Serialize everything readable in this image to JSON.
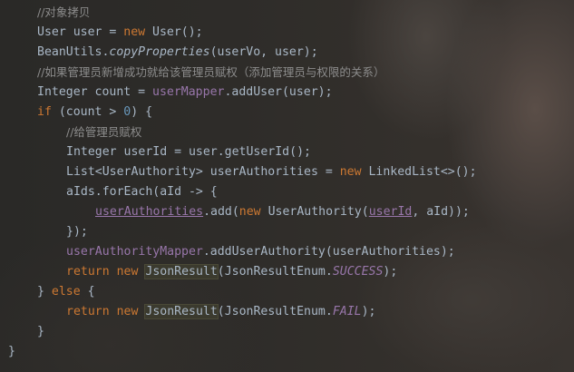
{
  "code_lines": [
    {
      "indent": 41,
      "tokens": [
        {
          "t": "//对象拷贝",
          "c": "comment"
        }
      ]
    },
    {
      "indent": 41,
      "tokens": [
        {
          "t": "User user = ",
          "c": "plain"
        },
        {
          "t": "new",
          "c": "keyword"
        },
        {
          "t": " User();",
          "c": "plain"
        }
      ]
    },
    {
      "indent": 41,
      "tokens": [
        {
          "t": "BeanUtils.",
          "c": "plain"
        },
        {
          "t": "copyProperties",
          "c": "italic"
        },
        {
          "t": "(userVo, user);",
          "c": "plain"
        }
      ]
    },
    {
      "indent": 41,
      "tokens": [
        {
          "t": "//如果管理员新增成功就给该管理员赋权（添加管理员与权限的关系）",
          "c": "comment"
        }
      ]
    },
    {
      "indent": 41,
      "tokens": [
        {
          "t": "Integer count = ",
          "c": "plain"
        },
        {
          "t": "userMapper",
          "c": "field"
        },
        {
          "t": ".addUser(user);",
          "c": "plain"
        }
      ]
    },
    {
      "indent": 41,
      "tokens": [
        {
          "t": "if",
          "c": "keyword"
        },
        {
          "t": " (count > ",
          "c": "plain"
        },
        {
          "t": "0",
          "c": "number"
        },
        {
          "t": ") {",
          "c": "plain"
        }
      ]
    },
    {
      "indent": 73,
      "tokens": [
        {
          "t": "//给管理员赋权",
          "c": "comment"
        }
      ]
    },
    {
      "indent": 73,
      "tokens": [
        {
          "t": "Integer userId = user.getUserId();",
          "c": "plain"
        }
      ]
    },
    {
      "indent": 73,
      "tokens": [
        {
          "t": "List<UserAuthority> userAuthorities = ",
          "c": "plain"
        },
        {
          "t": "new",
          "c": "keyword"
        },
        {
          "t": " LinkedList<>();",
          "c": "plain"
        }
      ]
    },
    {
      "indent": 73,
      "tokens": [
        {
          "t": "aIds.forEach(aId -> {",
          "c": "plain"
        }
      ]
    },
    {
      "indent": 105,
      "tokens": [
        {
          "t": "userAuthorities",
          "c": "field-underline"
        },
        {
          "t": ".add(",
          "c": "plain"
        },
        {
          "t": "new",
          "c": "keyword"
        },
        {
          "t": " UserAuthority(",
          "c": "plain"
        },
        {
          "t": "userId",
          "c": "field-underline"
        },
        {
          "t": ", aId));",
          "c": "plain"
        }
      ]
    },
    {
      "indent": 73,
      "tokens": [
        {
          "t": "});",
          "c": "plain"
        }
      ]
    },
    {
      "indent": 73,
      "tokens": [
        {
          "t": "userAuthorityMapper",
          "c": "field"
        },
        {
          "t": ".addUserAuthority(userAuthorities);",
          "c": "plain"
        }
      ]
    },
    {
      "indent": 73,
      "tokens": [
        {
          "t": "return",
          "c": "keyword"
        },
        {
          "t": " ",
          "c": "plain"
        },
        {
          "t": "new",
          "c": "keyword"
        },
        {
          "t": " ",
          "c": "plain"
        },
        {
          "t": "JsonResult",
          "c": "highlight"
        },
        {
          "t": "(JsonResultEnum.",
          "c": "plain"
        },
        {
          "t": "SUCCESS",
          "c": "static"
        },
        {
          "t": ");",
          "c": "plain"
        }
      ]
    },
    {
      "indent": 41,
      "tokens": [
        {
          "t": "} ",
          "c": "plain"
        },
        {
          "t": "else",
          "c": "keyword"
        },
        {
          "t": " {",
          "c": "plain"
        }
      ]
    },
    {
      "indent": 73,
      "tokens": [
        {
          "t": "return",
          "c": "keyword"
        },
        {
          "t": " ",
          "c": "plain"
        },
        {
          "t": "new",
          "c": "keyword"
        },
        {
          "t": " ",
          "c": "plain"
        },
        {
          "t": "JsonResult",
          "c": "highlight"
        },
        {
          "t": "(JsonResultEnum.",
          "c": "plain"
        },
        {
          "t": "FAIL",
          "c": "static"
        },
        {
          "t": ");",
          "c": "plain"
        }
      ]
    },
    {
      "indent": 41,
      "tokens": [
        {
          "t": "}",
          "c": "plain"
        }
      ]
    },
    {
      "indent": 9,
      "tokens": [
        {
          "t": "}",
          "c": "plain"
        }
      ]
    }
  ],
  "colors": {
    "keyword": "#cc7832",
    "field": "#9876aa",
    "number": "#6897bb",
    "comment": "#8c8c8c",
    "plain": "#a9b7c6"
  }
}
